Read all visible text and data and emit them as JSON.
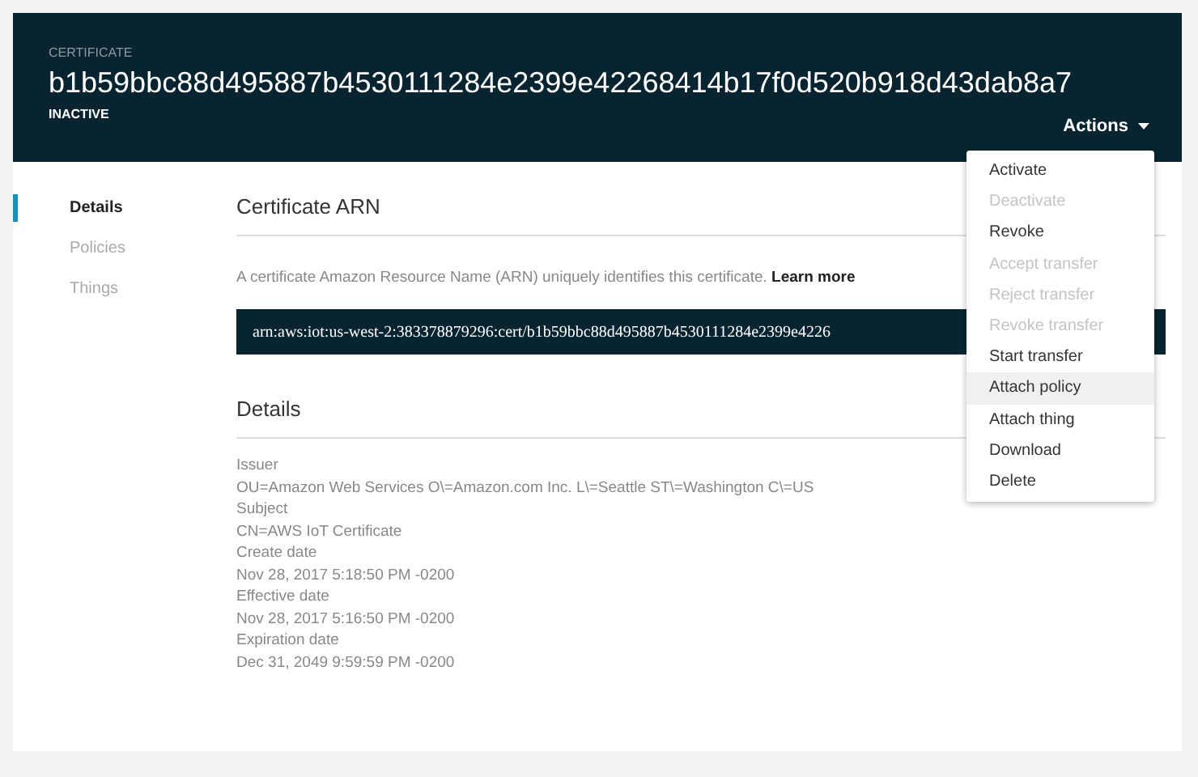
{
  "header": {
    "label": "CERTIFICATE",
    "title": "b1b59bbc88d495887b4530111284e2399e42268414b17f0d520b918d43dab8a7",
    "status": "INACTIVE",
    "actions_button": "Actions"
  },
  "sidebar": {
    "items": [
      {
        "label": "Details",
        "selected": true
      },
      {
        "label": "Policies",
        "selected": false
      },
      {
        "label": "Things",
        "selected": false
      }
    ]
  },
  "arn_section": {
    "heading": "Certificate ARN",
    "description": "A certificate Amazon Resource Name (ARN) uniquely identifies this certificate.",
    "link": "Learn more",
    "arn": "arn:aws:iot:us-west-2:383378879296:cert/b1b59bbc88d495887b4530111284e2399e4226"
  },
  "details_section": {
    "heading": "Details",
    "fields": [
      {
        "label": "Issuer",
        "value": "OU=Amazon Web Services O\\=Amazon.com Inc. L\\=Seattle ST\\=Washington C\\=US"
      },
      {
        "label": "Subject",
        "value": "CN=AWS IoT Certificate"
      },
      {
        "label": "Create date",
        "value": "Nov 28, 2017 5:18:50 PM -0200"
      },
      {
        "label": "Effective date",
        "value": "Nov 28, 2017 5:16:50 PM -0200"
      },
      {
        "label": "Expiration date",
        "value": "Dec 31, 2049 9:59:59 PM -0200"
      }
    ]
  },
  "actions_menu": {
    "items": [
      {
        "label": "Activate",
        "disabled": false,
        "selected": false
      },
      {
        "label": "Deactivate",
        "disabled": true,
        "selected": false
      },
      {
        "label": "Revoke",
        "disabled": false,
        "selected": false
      },
      {
        "label": "Accept transfer",
        "disabled": true,
        "selected": false
      },
      {
        "label": "Reject transfer",
        "disabled": true,
        "selected": false
      },
      {
        "label": "Revoke transfer",
        "disabled": true,
        "selected": false
      },
      {
        "label": "Start transfer",
        "disabled": false,
        "selected": false
      },
      {
        "label": "Attach policy",
        "disabled": false,
        "selected": true
      },
      {
        "label": "Attach thing",
        "disabled": false,
        "selected": false
      },
      {
        "label": "Download",
        "disabled": false,
        "selected": false
      },
      {
        "label": "Delete",
        "disabled": false,
        "selected": false
      }
    ]
  }
}
